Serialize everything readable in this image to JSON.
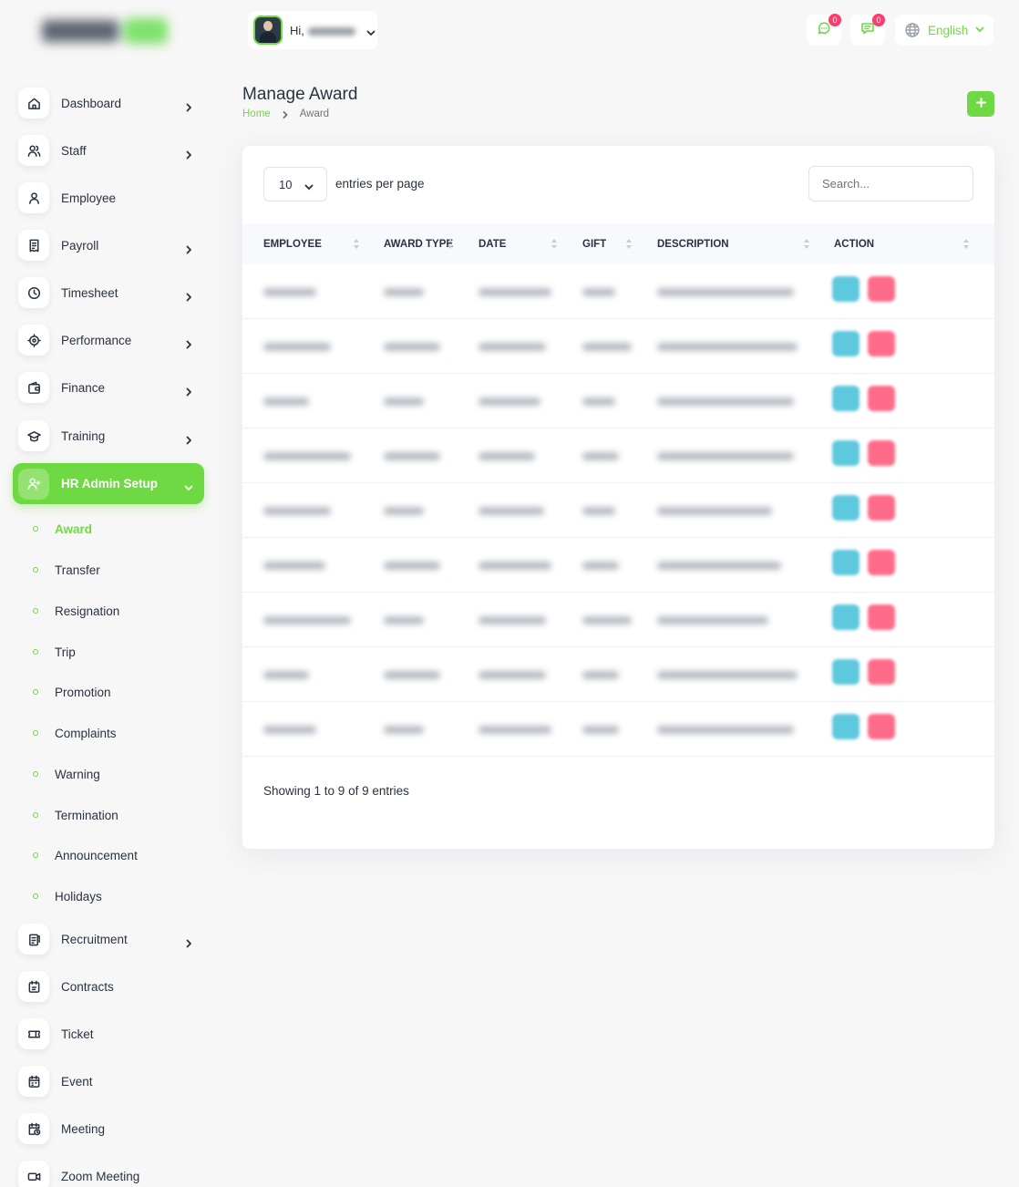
{
  "sidebar": {
    "items": [
      {
        "label": "Dashboard",
        "icon": "home-icon",
        "chevron": true
      },
      {
        "label": "Staff",
        "icon": "users-icon",
        "chevron": true
      },
      {
        "label": "Employee",
        "icon": "user-icon",
        "chevron": false
      },
      {
        "label": "Payroll",
        "icon": "receipt-icon",
        "chevron": true
      },
      {
        "label": "Timesheet",
        "icon": "clock-icon",
        "chevron": true
      },
      {
        "label": "Performance",
        "icon": "target-icon",
        "chevron": true
      },
      {
        "label": "Finance",
        "icon": "wallet-icon",
        "chevron": true
      },
      {
        "label": "Training",
        "icon": "graduation-cap-icon",
        "chevron": true
      },
      {
        "label": "HR Admin Setup",
        "icon": "user-plus-icon",
        "chevron": true,
        "active": true
      }
    ],
    "sub_items": [
      "Award",
      "Transfer",
      "Resignation",
      "Trip",
      "Promotion",
      "Complaints",
      "Warning",
      "Termination",
      "Announcement",
      "Holidays"
    ],
    "current_sub": "Award",
    "bottom_items": [
      {
        "label": "Recruitment",
        "icon": "clipboard-icon",
        "chevron": true
      },
      {
        "label": "Contracts",
        "icon": "contract-icon",
        "chevron": false
      },
      {
        "label": "Ticket",
        "icon": "ticket-icon",
        "chevron": false
      },
      {
        "label": "Event",
        "icon": "calendar-icon",
        "chevron": false
      },
      {
        "label": "Meeting",
        "icon": "calendar-clock-icon",
        "chevron": false
      },
      {
        "label": "Zoom Meeting",
        "icon": "video-icon",
        "chevron": false
      }
    ]
  },
  "header": {
    "greeting": "Hi,",
    "messages_count": "0",
    "chat_count": "0",
    "language": "English"
  },
  "page": {
    "title": "Manage Award",
    "breadcrumb_home": "Home",
    "breadcrumb_current": "Award"
  },
  "table": {
    "per_page": "10",
    "per_page_label": "entries per page",
    "search_placeholder": "Search...",
    "columns": [
      "EMPLOYEE",
      "AWARD TYPE",
      "DATE",
      "GIFT",
      "DESCRIPTION",
      "ACTION"
    ],
    "row_count": 9,
    "footer": "Showing 1 to 9 of 9 entries"
  },
  "colors": {
    "accent": "#6fd943",
    "edit": "#5ec8dd",
    "delete": "#ff6b8a",
    "badge": "#ff3a6e"
  }
}
